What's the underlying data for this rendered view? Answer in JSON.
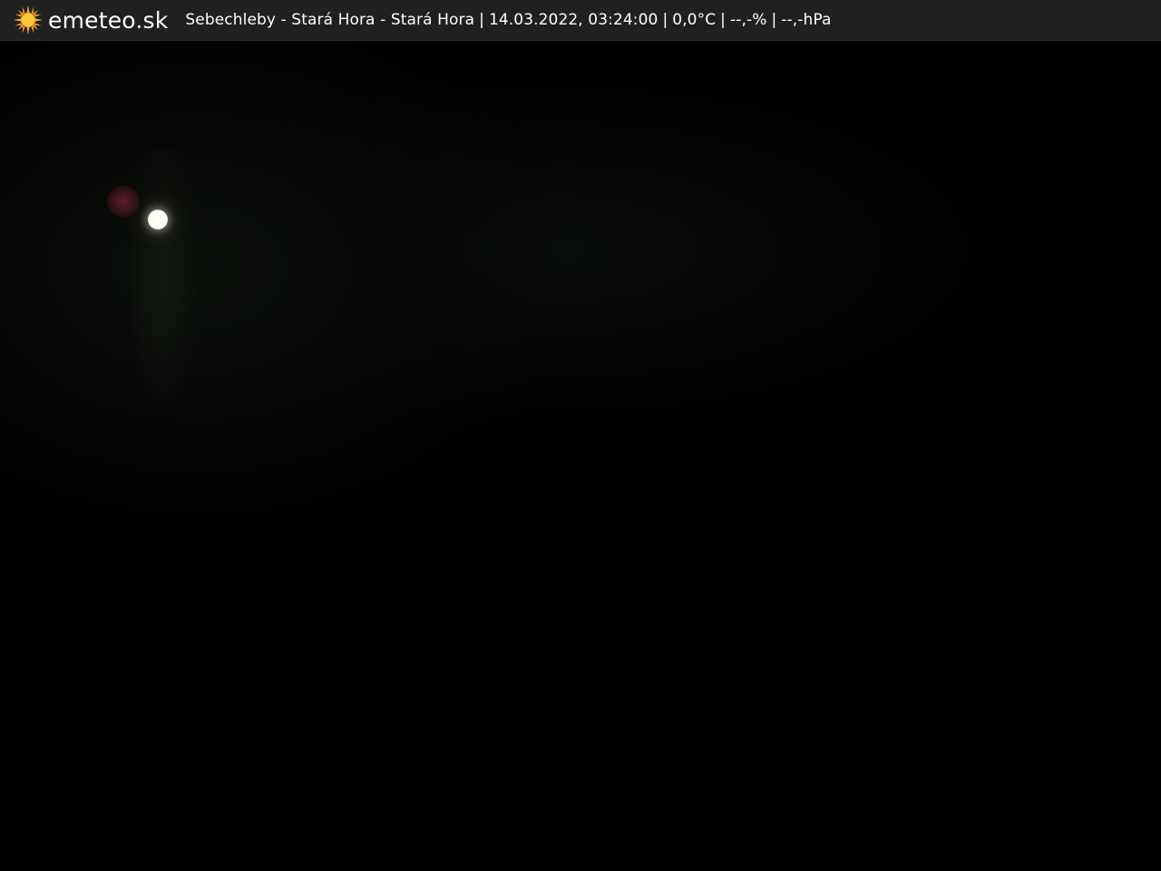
{
  "header": {
    "logo_icon": "sun-icon",
    "logo_text": "emeteo.sk",
    "location": "Sebechleby - Stará Hora - Stará Hora",
    "datetime": "14.03.2022, 03:24:00",
    "temperature": "0,0°C",
    "humidity": "--,-%",
    "pressure": "--,-hPa",
    "separator": "|"
  },
  "colors": {
    "header_bg": "#202020",
    "header_text": "#ffffff",
    "sun_icon": "#f5a623",
    "scene_bg": "#000000"
  }
}
